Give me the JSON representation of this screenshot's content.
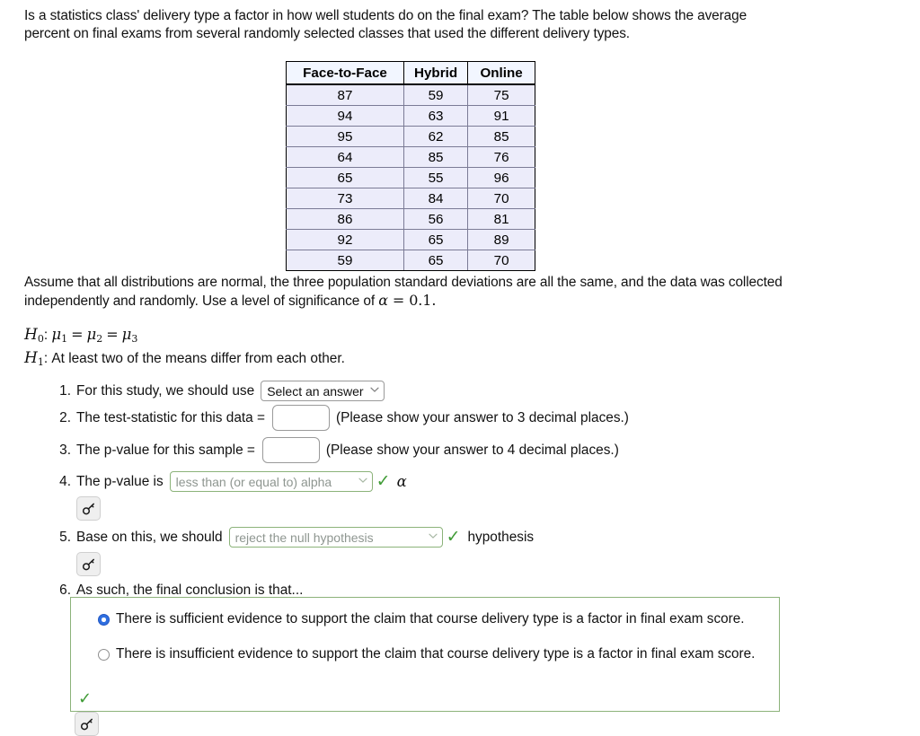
{
  "problem": {
    "intro": "Is a statistics class' delivery type a factor in how well students do on the final exam? The table below shows the average percent on final exams from several randomly selected classes that used the different delivery types.",
    "assumption_part1": "Assume that all distributions are normal, the three population standard deviations are all the same, and the data was collected independently and randomly. Use a level of significance of ",
    "alpha_symbol": "α",
    "equals_symbol": "=",
    "alpha_value": "0.1",
    "period": "."
  },
  "table": {
    "headers": [
      "Face-to-Face",
      "Hybrid",
      "Online"
    ],
    "rows": [
      [
        "87",
        "59",
        "75"
      ],
      [
        "94",
        "63",
        "91"
      ],
      [
        "95",
        "62",
        "85"
      ],
      [
        "64",
        "85",
        "76"
      ],
      [
        "65",
        "55",
        "96"
      ],
      [
        "73",
        "84",
        "70"
      ],
      [
        "86",
        "56",
        "81"
      ],
      [
        "92",
        "65",
        "89"
      ],
      [
        "59",
        "65",
        "70"
      ]
    ]
  },
  "hypotheses": {
    "h0_symbol": "H",
    "h0_sub": "0",
    "h0_colon": ":",
    "mu": "μ",
    "mu1_sub": "1",
    "mu2_sub": "2",
    "mu3_sub": "3",
    "eq": "=",
    "h1_symbol": "H",
    "h1_sub": "1",
    "h1_colon": ":",
    "h1_text": "At least two of the means differ from each other."
  },
  "steps": [
    {
      "number": "1.",
      "text_before": "For this study, we should use",
      "select_value": "Select an answer",
      "select_state": "unanswered",
      "caret": "⌄"
    },
    {
      "number": "2.",
      "text_before": "The test-statistic for this data =",
      "input_value": "",
      "text_after": "(Please show your answer to 3 decimal places.)"
    },
    {
      "number": "3.",
      "text_before": "The p-value for this sample =",
      "input_value": "",
      "text_after": "(Please show your answer to 4 decimal places.)"
    },
    {
      "number": "4.",
      "text_before": "The p-value is",
      "select_value": "less than (or equal to) alpha",
      "select_state": "correct",
      "caret": "⌄",
      "check": "✓",
      "text_after": "α"
    },
    {
      "number": "5.",
      "text_before": "Base on this, we should",
      "select_value": "reject the null hypothesis",
      "select_state": "correct",
      "caret": "⌄",
      "check": "✓",
      "text_after": "hypothesis"
    },
    {
      "number": "6.",
      "text_before": "As such, the final conclusion is that..."
    }
  ],
  "conclusion": {
    "option_1": "There is sufficient evidence to support the claim that course delivery type is a factor in final exam score.",
    "option_1_selected": true,
    "option_2": "There is insufficient evidence to support the claim that course delivery type is a factor in final exam score.",
    "option_2_selected": false,
    "box_check": "✓"
  },
  "icons": {
    "key_icon": "key-icon",
    "check_icon": "check-icon",
    "chevron_down_icon": "chevron-down-icon"
  },
  "colors": {
    "correct_green": "#3f9b35",
    "correct_border": "#8cb37a",
    "radio_blue": "#2f6fe0",
    "table_cell_bg": "#ececfa",
    "table_header_bg": "#f2f6ff"
  }
}
